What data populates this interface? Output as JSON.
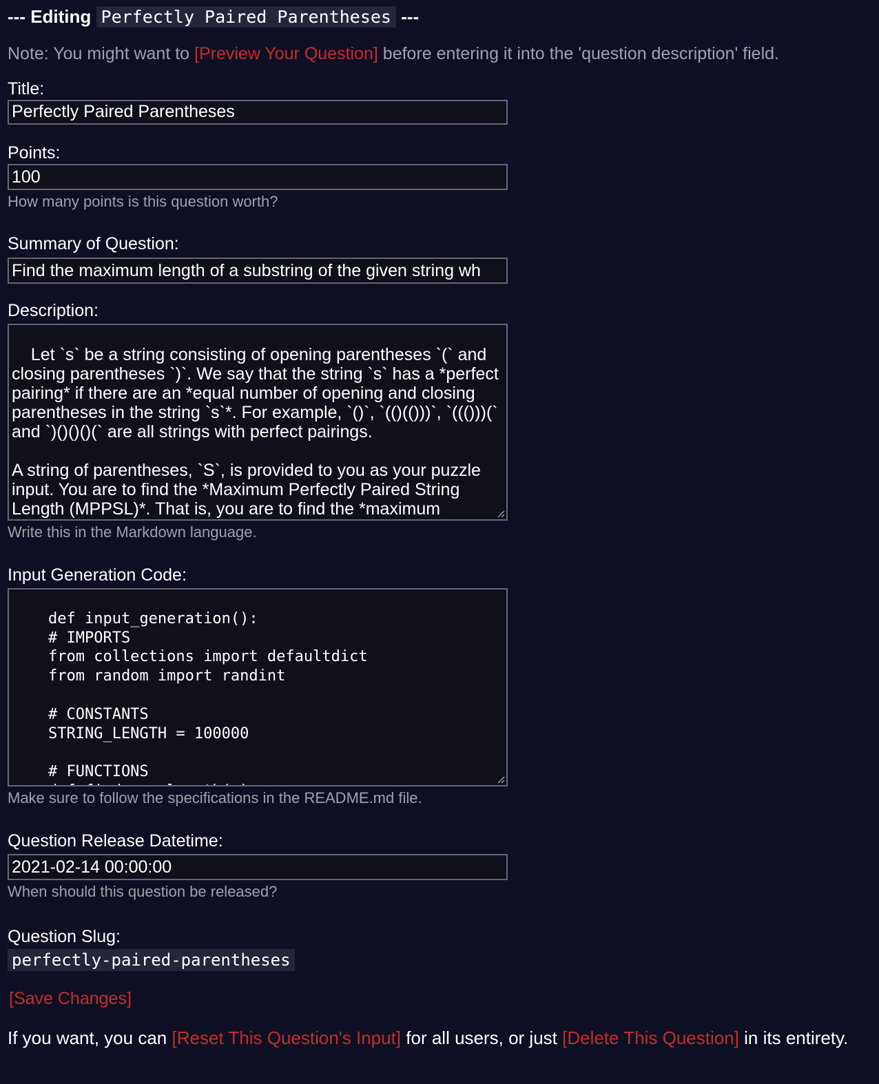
{
  "heading": {
    "prefix": "--- Editing",
    "question_name": "Perfectly Paired Parentheses",
    "suffix": "---"
  },
  "note": {
    "before": "Note: You might want to",
    "link": "[Preview Your Question]",
    "after": "before entering it into the 'question description' field."
  },
  "fields": {
    "title": {
      "label": "Title:",
      "value": "Perfectly Paired Parentheses"
    },
    "points": {
      "label": "Points:",
      "value": "100",
      "help": "How many points is this question worth?"
    },
    "summary": {
      "label": "Summary of Question:",
      "value": "Find the maximum length of a substring of the given string wh"
    },
    "description": {
      "label": "Description:",
      "value": "Let `s` be a string consisting of opening parentheses `(` and closing parentheses `)`. We say that the string `s` has a *perfect pairing* if there are an *equal number of opening and closing parentheses in the string `s`*. For example, `()`, `(()(()))`, `((()))(` and `)()()()(` are all strings with perfect pairings.\n\nA string of parentheses, `S`, is provided to you as your puzzle input. You are to find the *Maximum Perfectly Paired String Length (MPPSL)*. That is, you are to find the *maximum",
      "help": "Write this in the Markdown language."
    },
    "input_code": {
      "label": "Input Generation Code:",
      "value": "def input_generation():\n    # IMPORTS\n    from collections import defaultdict\n    from random import randint\n\n    # CONSTANTS\n    STRING_LENGTH = 100000\n\n    # FUNCTIONS\n    def find_max_length(s):",
      "help": "Make sure to follow the specifications in the README.md file."
    },
    "release": {
      "label": "Question Release Datetime:",
      "value": "2021-02-14 00:00:00",
      "help": "When should this question be released?"
    },
    "slug": {
      "label": "Question Slug:",
      "value": "perfectly-paired-parentheses"
    }
  },
  "save_label": "[Save Changes]",
  "footer": {
    "before": "If you want, you can",
    "reset_link": "[Reset This Question's Input]",
    "middle": "for all users, or just",
    "delete_link": "[Delete This Question]",
    "after": "in its entirety."
  },
  "colors": {
    "background": "#0f0f23",
    "link": "#c42b2b",
    "muted_text": "#a0a0a8",
    "input_border": "#666677"
  }
}
